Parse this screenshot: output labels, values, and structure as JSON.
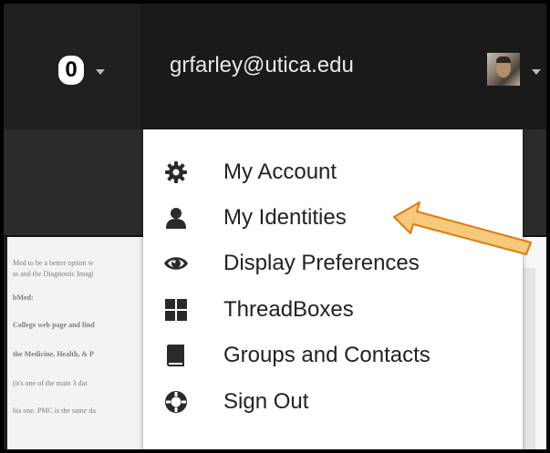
{
  "navbar": {
    "counter": "0",
    "user_email": "grfarley@utica.edu",
    "icons": {
      "counter_caret": "chevron-down-icon",
      "user_caret": "chevron-down-icon",
      "avatar": "avatar-photo"
    }
  },
  "menu": {
    "items": [
      {
        "label": "My Account",
        "icon": "gear-icon"
      },
      {
        "label": "My Identities",
        "icon": "person-icon"
      },
      {
        "label": "Display Preferences",
        "icon": "eye-icon"
      },
      {
        "label": "ThreadBoxes",
        "icon": "grid-icon"
      },
      {
        "label": "Groups and Contacts",
        "icon": "book-icon"
      },
      {
        "label": "Sign Out",
        "icon": "sign-out-icon"
      }
    ]
  },
  "background_doc": {
    "lines": [
      "Med to be a better option w",
      "ss and the Diagnostic Imagi",
      "bMed:",
      "College web page and find",
      "the Medicine, Health, & P",
      "(it's one of the main 3 dat",
      "his one. PMC is the same da"
    ]
  },
  "colors": {
    "navbar_bg": "#1a1a1a",
    "menu_bg": "#ffffff",
    "arrow_fill": "#f6c87a",
    "arrow_stroke": "#e07a10"
  }
}
